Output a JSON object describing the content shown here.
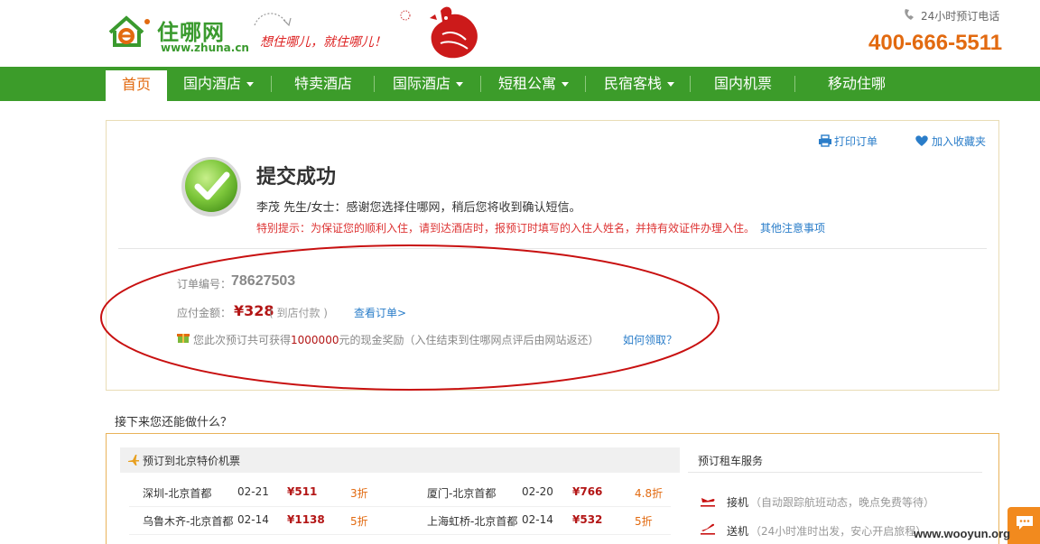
{
  "header": {
    "logo_title": "住哪网",
    "logo_url": "www.zhuna.cn",
    "slogan": "想住哪儿，就住哪儿！",
    "hotline_label": "24小时预订电话",
    "hotline_number": "400-666-5511"
  },
  "nav": {
    "items": [
      {
        "label": "首页",
        "dropdown": false,
        "active": true
      },
      {
        "label": "国内酒店",
        "dropdown": true
      },
      {
        "label": "特卖酒店",
        "dropdown": false
      },
      {
        "label": "国际酒店",
        "dropdown": true
      },
      {
        "label": "短租公寓",
        "dropdown": true
      },
      {
        "label": "民宿客栈",
        "dropdown": true
      },
      {
        "label": "国内机票",
        "dropdown": false
      },
      {
        "label": "移动住哪",
        "dropdown": false
      }
    ]
  },
  "success": {
    "print_label": "打印订单",
    "favorite_label": "加入收藏夹",
    "title": "提交成功",
    "thanks": "李茂 先生/女士：感谢您选择住哪网，稍后您将收到确认短信。",
    "tip": "特别提示：为保证您的顺利入住，请到达酒店时，报预订时填写的入住人姓名，并持有效证件办理入住。",
    "tip_more": "其他注意事项",
    "order_label": "订单编号：",
    "order_no": "78627503",
    "pay_label": "应付金额：",
    "pay_amount": "¥328",
    "pay_note": "( 到店付款 )",
    "view_order": "查看订单>",
    "reward_prefix": "您此次预订共可获得",
    "reward_amount": "1000000",
    "reward_suffix": "元的现金奖励（入住结束到住哪网点评后由网站返还）",
    "how_to_claim": "如何领取？"
  },
  "next": {
    "title": "接下来您还能做什么？",
    "flight_section_title": "预订到北京特价机票",
    "flights": [
      {
        "route": "深圳-北京首都",
        "date": "02-21",
        "price": "¥511",
        "discount": "3折"
      },
      {
        "route": "厦门-北京首都",
        "date": "02-20",
        "price": "¥766",
        "discount": "4.8折"
      },
      {
        "route": "乌鲁木齐-北京首都",
        "date": "02-14",
        "price": "¥1138",
        "discount": "5折"
      },
      {
        "route": "上海虹桥-北京首都",
        "date": "02-14",
        "price": "¥532",
        "discount": "5折"
      }
    ],
    "car_section_title": "预订租车服务",
    "car_services": [
      {
        "name": "接机",
        "desc": "（自动跟踪航班动态，晚点免费等待）"
      },
      {
        "name": "送机",
        "desc": "（24小时准时出发，安心开启旅程）"
      }
    ]
  },
  "watermark": "www.wooyun.org",
  "colors": {
    "brand_green": "#3c9c2a",
    "accent_orange": "#e26a10",
    "price_red": "#b31515",
    "link_blue": "#2a7dc9",
    "annotation_red": "#c81010"
  }
}
